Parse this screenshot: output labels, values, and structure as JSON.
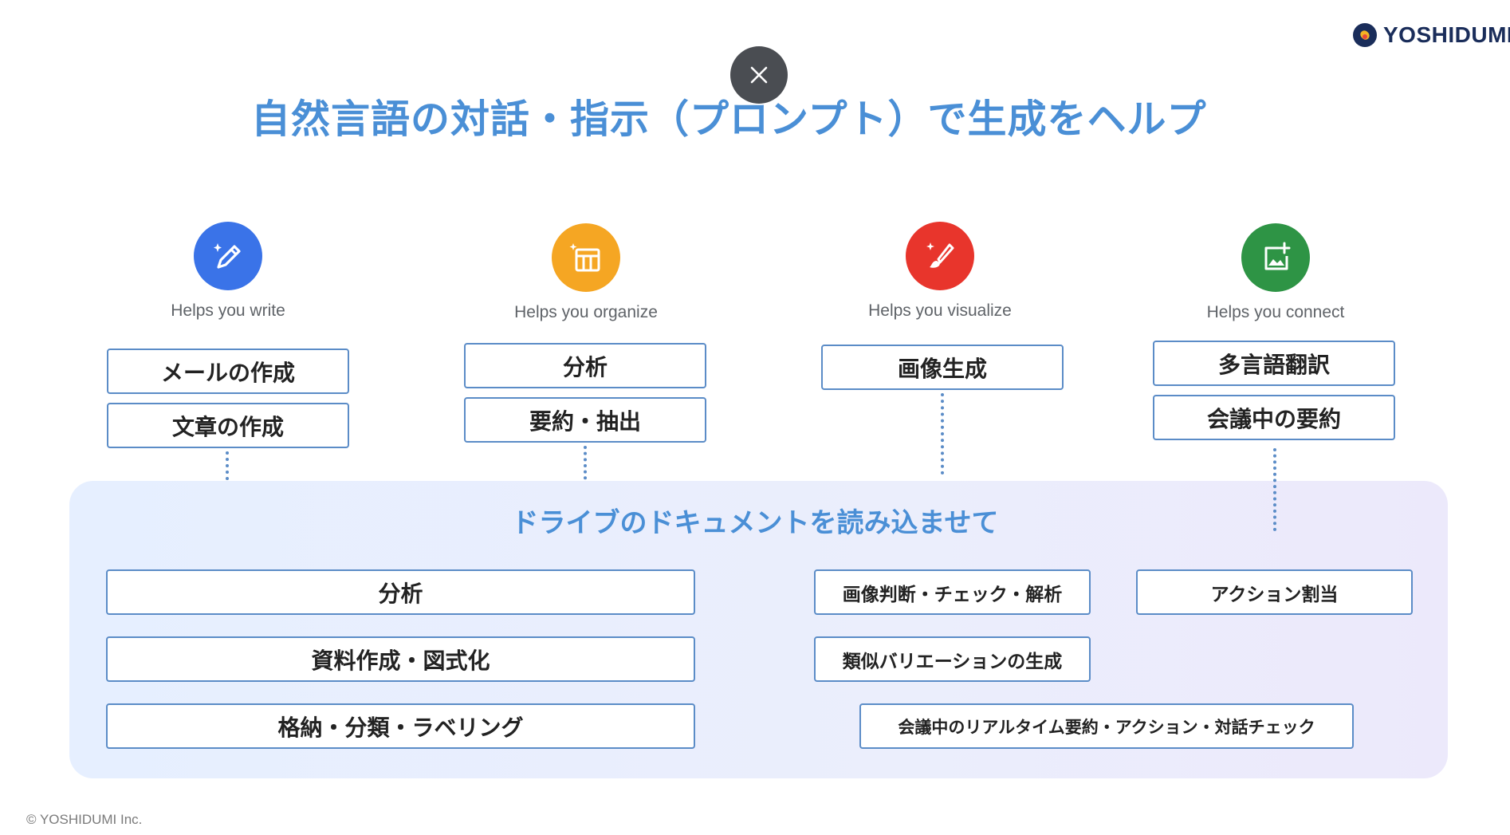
{
  "logo": {
    "text": "YOSHIDUMI"
  },
  "title": "自然言語の対話・指示（プロンプト）で生成をヘルプ",
  "features": [
    {
      "icon": "pen-sparkle-icon",
      "label": "Helps you write",
      "color": "#3a73e8",
      "items": [
        "メールの作成",
        "文章の作成"
      ]
    },
    {
      "icon": "table-sparkle-icon",
      "label": "Helps you organize",
      "color": "#f5a623",
      "items": [
        "分析",
        "要約・抽出"
      ]
    },
    {
      "icon": "brush-sparkle-icon",
      "label": "Helps you visualize",
      "color": "#e8352c",
      "items": [
        "画像生成"
      ]
    },
    {
      "icon": "image-add-icon",
      "label": "Helps you connect",
      "color": "#2e9445",
      "items": [
        "多言語翻訳",
        "会議中の要約"
      ]
    }
  ],
  "panel": {
    "title": "ドライブのドキュメントを読み込ませて",
    "items": [
      "分析",
      "資料作成・図式化",
      "格納・分類・ラベリング",
      "画像判断・チェック・解析",
      "類似バリエーションの生成",
      "アクション割当",
      "会議中のリアルタイム要約・アクション・対話チェック"
    ]
  },
  "footer": "© YOSHIDUMI  Inc."
}
